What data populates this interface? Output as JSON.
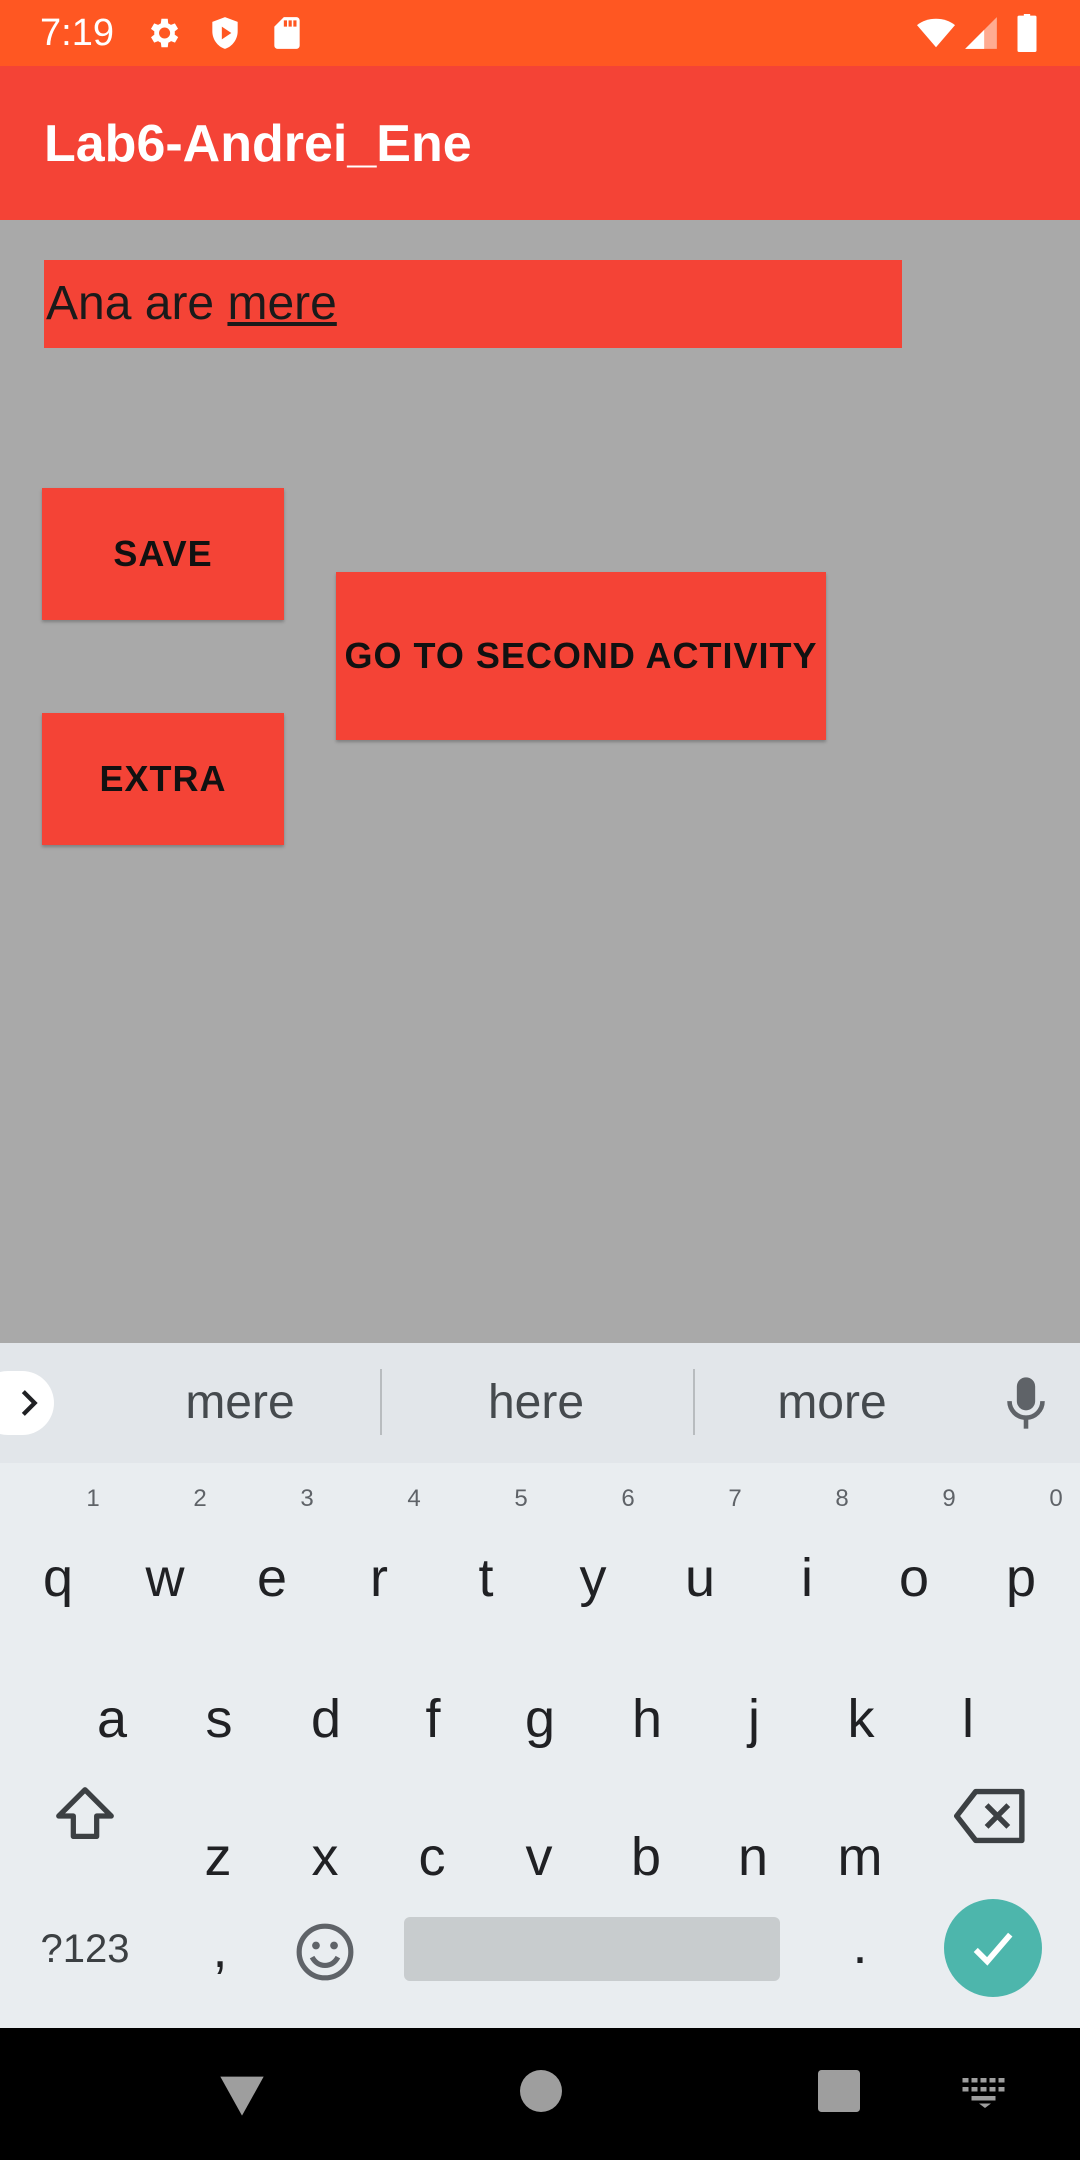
{
  "status_bar": {
    "time": "7:19",
    "icons_left": [
      "gear-icon",
      "shield-icon",
      "sd-card-icon"
    ],
    "icons_right": [
      "wifi-icon",
      "signal-icon",
      "battery-icon"
    ]
  },
  "app_bar": {
    "title": "Lab6-Andrei_Ene"
  },
  "text_field": {
    "text_plain": "Ana are ",
    "text_underlined": "mere"
  },
  "buttons": {
    "save": "SAVE",
    "extra": "EXTRA",
    "second": "GO TO SECOND ACTIVITY"
  },
  "keyboard": {
    "suggestions": [
      "mere",
      "here",
      "more"
    ],
    "row1": [
      "q",
      "w",
      "e",
      "r",
      "t",
      "y",
      "u",
      "i",
      "o",
      "p"
    ],
    "row1_hints": [
      "1",
      "2",
      "3",
      "4",
      "5",
      "6",
      "7",
      "8",
      "9",
      "0"
    ],
    "row2": [
      "a",
      "s",
      "d",
      "f",
      "g",
      "h",
      "j",
      "k",
      "l"
    ],
    "row3": [
      "z",
      "x",
      "c",
      "v",
      "b",
      "n",
      "m"
    ],
    "symbols_label": "?123",
    "comma": ",",
    "period": "."
  },
  "colors": {
    "status_bar": "#ff5722",
    "app_bar": "#f44336",
    "background": "#a9a9a9",
    "enter_key": "#4db6ac"
  }
}
